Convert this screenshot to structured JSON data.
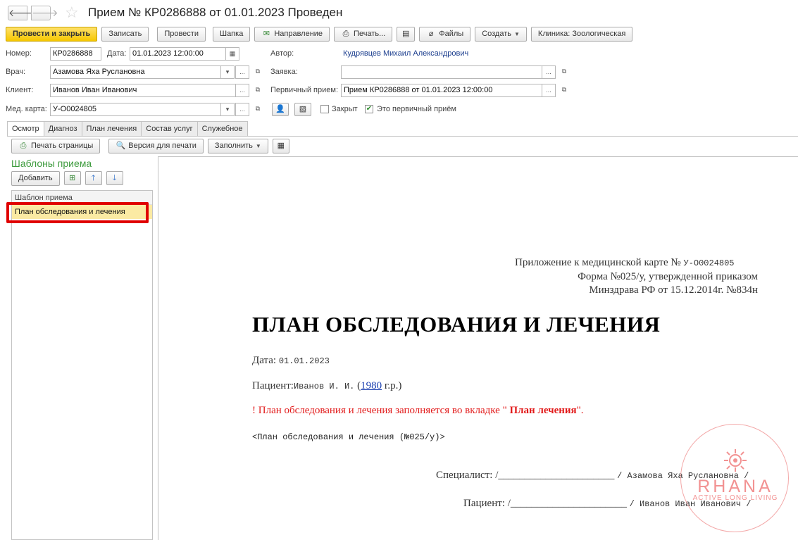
{
  "window": {
    "title": "Прием № КР0286888 от 01.01.2023 Проведен"
  },
  "toolbar": {
    "post_close": "Провести и закрыть",
    "save": "Записать",
    "post": "Провести",
    "header": "Шапка",
    "referral": "Направление",
    "print": "Печать...",
    "files": "Файлы",
    "create": "Создать",
    "clinic": "Клиника: Зоологическая"
  },
  "form": {
    "number_label": "Номер:",
    "number": "КР0286888",
    "date_label": "Дата:",
    "date": "01.01.2023 12:00:00",
    "author_label": "Автор:",
    "author": "Кудрявцев Михаил Александрович",
    "doctor_label": "Врач:",
    "doctor": "Азамова Яха Руслановна",
    "request_label": "Заявка:",
    "request": "",
    "client_label": "Клиент:",
    "client": "Иванов Иван Иванович",
    "primary_label": "Первичный прием:",
    "primary": "Прием КР0286888 от 01.01.2023 12:00:00",
    "card_label": "Мед. карта:",
    "card": "У-О0024805",
    "closed_label": "Закрыт",
    "closed": false,
    "is_primary_label": "Это первичный приём",
    "is_primary": true
  },
  "tabs": [
    {
      "label": "Осмотр",
      "active": true
    },
    {
      "label": "Диагноз",
      "active": false
    },
    {
      "label": "План лечения",
      "active": false
    },
    {
      "label": "Состав услуг",
      "active": false
    },
    {
      "label": "Служебное",
      "active": false
    }
  ],
  "toolbar2": {
    "print_page": "Печать страницы",
    "print_version": "Версия для печати",
    "fill": "Заполнить"
  },
  "templates": {
    "title": "Шаблоны приема",
    "add": "Добавить",
    "column": "Шаблон приема",
    "rows": [
      "План обследования и лечения"
    ]
  },
  "document": {
    "appendix": "Приложение к медицинской карте №",
    "card_no": "У-О0024805",
    "form_line": "Форма №025/у, утвержденной приказом",
    "order_line": "Минздрава РФ от 15.12.2014г. №834н",
    "heading": "ПЛАН ОБСЛЕДОВАНИЯ И ЛЕЧЕНИЯ",
    "date_label": "Дата:",
    "date": "01.01.2023",
    "patient_label": "Пациент:",
    "patient_name": "Иванов И. И.",
    "birth_open": "(",
    "birth_year": "1980",
    "birth_suffix": "г.р.)",
    "note_prefix": "! План обследования и лечения заполняется во вкладке \"",
    "note_bold": " План лечения",
    "note_suffix": "\".",
    "placeholder": "<План обследования и лечения (№025/у)>",
    "specialist_label": "Специалист:",
    "specialist_line": "/______________________",
    "specialist_name": "/ Азамова Яха Руслановна /",
    "patient_sign_label": "Пациент:",
    "patient_sign_line": "/______________________",
    "patient_sign_name": "/ Иванов Иван Иванович /"
  },
  "watermark": {
    "name": "RHANA",
    "tagline": "ACTIVE LONG LIVING",
    "color": "#f08080"
  }
}
